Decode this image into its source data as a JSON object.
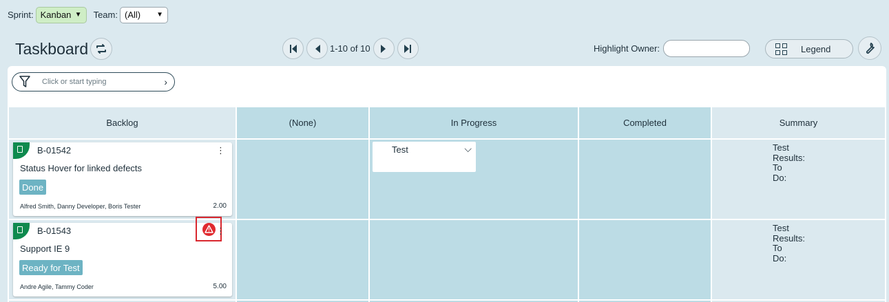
{
  "filters": {
    "sprint_label": "Sprint:",
    "sprint_value": "Kanban",
    "team_label": "Team:",
    "team_value": "(All)"
  },
  "header": {
    "title": "Taskboard",
    "pager_text": "1-10 of 10",
    "highlight_label": "Highlight Owner:",
    "highlight_value": "",
    "legend_label": "Legend"
  },
  "search": {
    "placeholder": "Click or start typing"
  },
  "columns": [
    "Backlog",
    "(None)",
    "In Progress",
    "Completed",
    "Summary"
  ],
  "rows": [
    {
      "id": "B-01542",
      "title": "Status Hover for linked defects",
      "status": "Done",
      "owners": "Alfred Smith, Danny Developer, Boris Tester",
      "estimate": "2.00",
      "task": "Test",
      "summary_results": "Test Results:",
      "summary_todo": "To Do:"
    },
    {
      "id": "B-01543",
      "title": "Support IE 9",
      "status": "Ready for Test",
      "owners": "Andre Agile, Tammy Coder",
      "estimate": "5.00",
      "summary_results": "Test Results:",
      "summary_todo": "To Do:"
    }
  ],
  "colors": {
    "accent_green": "#0e8a4e",
    "status_blue": "#6db3c3",
    "warning_red": "#e02a2f",
    "column_teal": "#bcdce5"
  }
}
